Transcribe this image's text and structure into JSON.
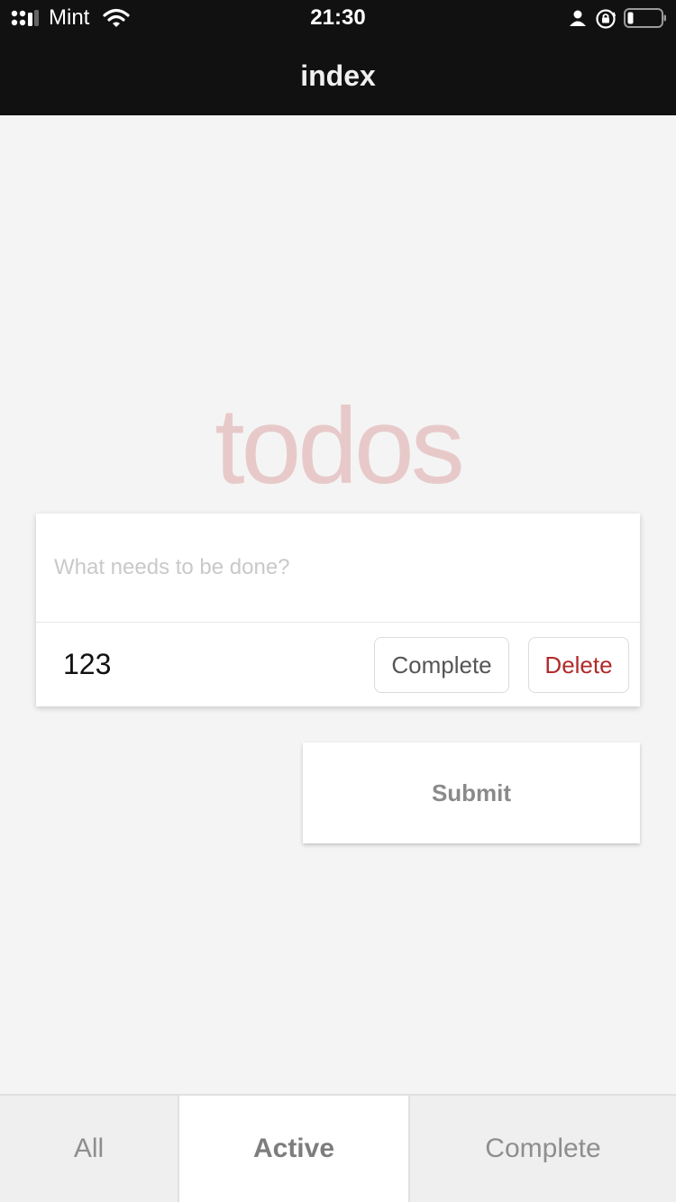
{
  "status_bar": {
    "carrier": "Mint",
    "time": "21:30",
    "icons": [
      "signal-icon",
      "wifi-icon",
      "user-icon",
      "rotation-lock-icon",
      "battery-icon"
    ]
  },
  "nav": {
    "title": "index"
  },
  "app": {
    "title": "todos",
    "new_todo_placeholder": "What needs to be done?",
    "todos": [
      {
        "text": "123",
        "complete_label": "Complete",
        "delete_label": "Delete"
      }
    ],
    "submit_label": "Submit"
  },
  "tabs": [
    {
      "label": "All",
      "selected": false
    },
    {
      "label": "Active",
      "selected": true
    },
    {
      "label": "Complete",
      "selected": false
    }
  ],
  "colors": {
    "title": "#e8c9c9",
    "delete": "#b02a2a",
    "header_bg": "#111111",
    "page_bg": "#f4f4f4"
  }
}
